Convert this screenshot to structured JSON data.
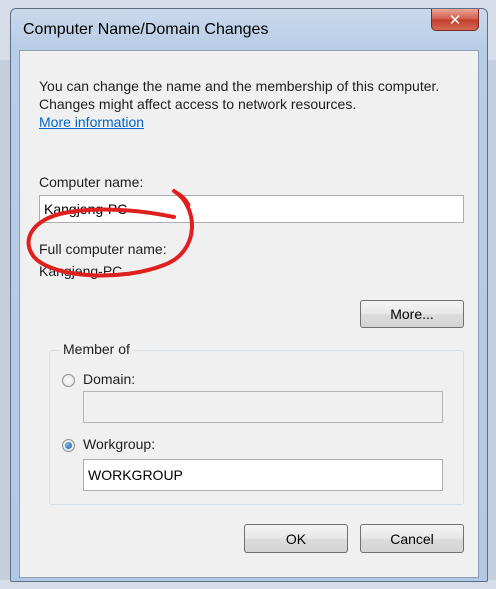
{
  "dialog": {
    "title": "Computer Name/Domain Changes",
    "close_glyph": "✕",
    "description": "You can change the name and the membership of this computer. Changes might affect access to network resources.",
    "more_info_link": "More information",
    "computer_name_label": "Computer name:",
    "computer_name_value": "Kangjeng-PC",
    "full_name_label": "Full computer name:",
    "full_name_value": "Kangjeng-PC",
    "more_button": "More...",
    "member_of_label": "Member of",
    "domain_label": "Domain:",
    "domain_value": "",
    "workgroup_label": "Workgroup:",
    "workgroup_value": "WORKGROUP",
    "selected_membership": "workgroup",
    "ok_button": "OK",
    "cancel_button": "Cancel"
  },
  "annotation": {
    "color": "#e01f1f",
    "shape": "hand-drawn-circle"
  }
}
